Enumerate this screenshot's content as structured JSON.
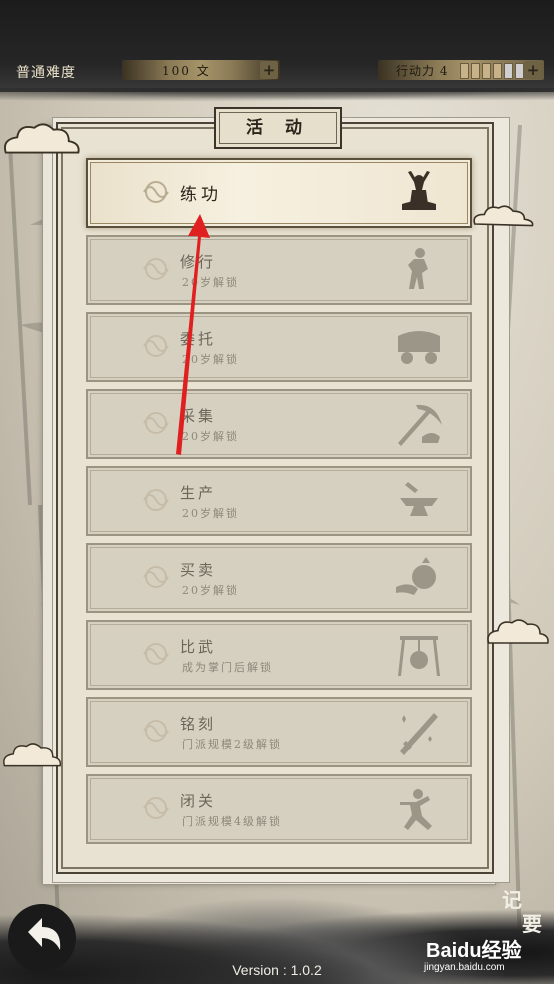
{
  "header": {
    "difficulty": "普通难度",
    "money": "100 文",
    "action_label": "行动力 4",
    "action_points": 4,
    "action_max": 6
  },
  "panel": {
    "title": "活 动",
    "items": [
      {
        "name": "练功",
        "sub": "",
        "icon": "meditation-icon",
        "active": true
      },
      {
        "name": "修行",
        "sub": "20岁解锁",
        "icon": "martial-pose-icon",
        "active": false
      },
      {
        "name": "委托",
        "sub": "20岁解锁",
        "icon": "cart-icon",
        "active": false
      },
      {
        "name": "采集",
        "sub": "20岁解锁",
        "icon": "pickaxe-icon",
        "active": false
      },
      {
        "name": "生产",
        "sub": "20岁解锁",
        "icon": "anvil-icon",
        "active": false
      },
      {
        "name": "买卖",
        "sub": "20岁解锁",
        "icon": "money-bag-icon",
        "active": false
      },
      {
        "name": "比武",
        "sub": "成为掌门后解锁",
        "icon": "gong-icon",
        "active": false
      },
      {
        "name": "铭刻",
        "sub": "门派规模2级解锁",
        "icon": "sword-icon",
        "active": false
      },
      {
        "name": "闭关",
        "sub": "门派规模4级解锁",
        "icon": "fighter-icon",
        "active": false
      }
    ]
  },
  "footer": {
    "version": "Version : 1.0.2",
    "notes_label": [
      "记",
      "要"
    ],
    "watermark": "Baidu经验",
    "watermark_sub": "jingyan.baidu.com"
  },
  "colors": {
    "topbar": "#1c1c1c",
    "panel": "#e8e2d2",
    "row": "#d6d0c1",
    "active_row": "#f6f0e0",
    "annotation_arrow": "#e02020"
  }
}
